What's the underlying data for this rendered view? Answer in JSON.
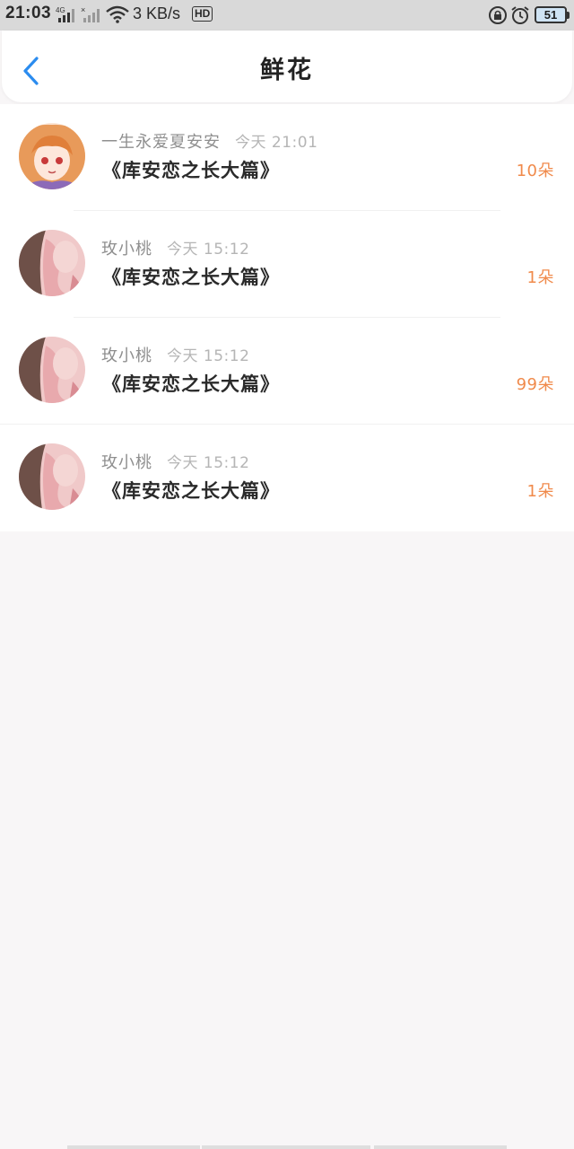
{
  "status_bar": {
    "time": "21:03",
    "speed": "3 KB/s",
    "hd": "HD",
    "battery": "51"
  },
  "header": {
    "title": "鲜花"
  },
  "list": [
    {
      "user": "一生永爱夏安安",
      "time": "今天 21:01",
      "book": "《库安恋之长大篇》",
      "count": "10朵",
      "avatar": "avatar-orange"
    },
    {
      "user": "玫小桃",
      "time": "今天 15:12",
      "book": "《库安恋之长大篇》",
      "count": "1朵",
      "avatar": "avatar-pink"
    },
    {
      "user": "玫小桃",
      "time": "今天 15:12",
      "book": "《库安恋之长大篇》",
      "count": "99朵",
      "avatar": "avatar-pink"
    },
    {
      "user": "玫小桃",
      "time": "今天 15:12",
      "book": "《库安恋之长大篇》",
      "count": "1朵",
      "avatar": "avatar-pink"
    }
  ],
  "colors": {
    "accent": "#2b8cef",
    "count": "#f08a4b",
    "background": "#f8f6f7"
  }
}
